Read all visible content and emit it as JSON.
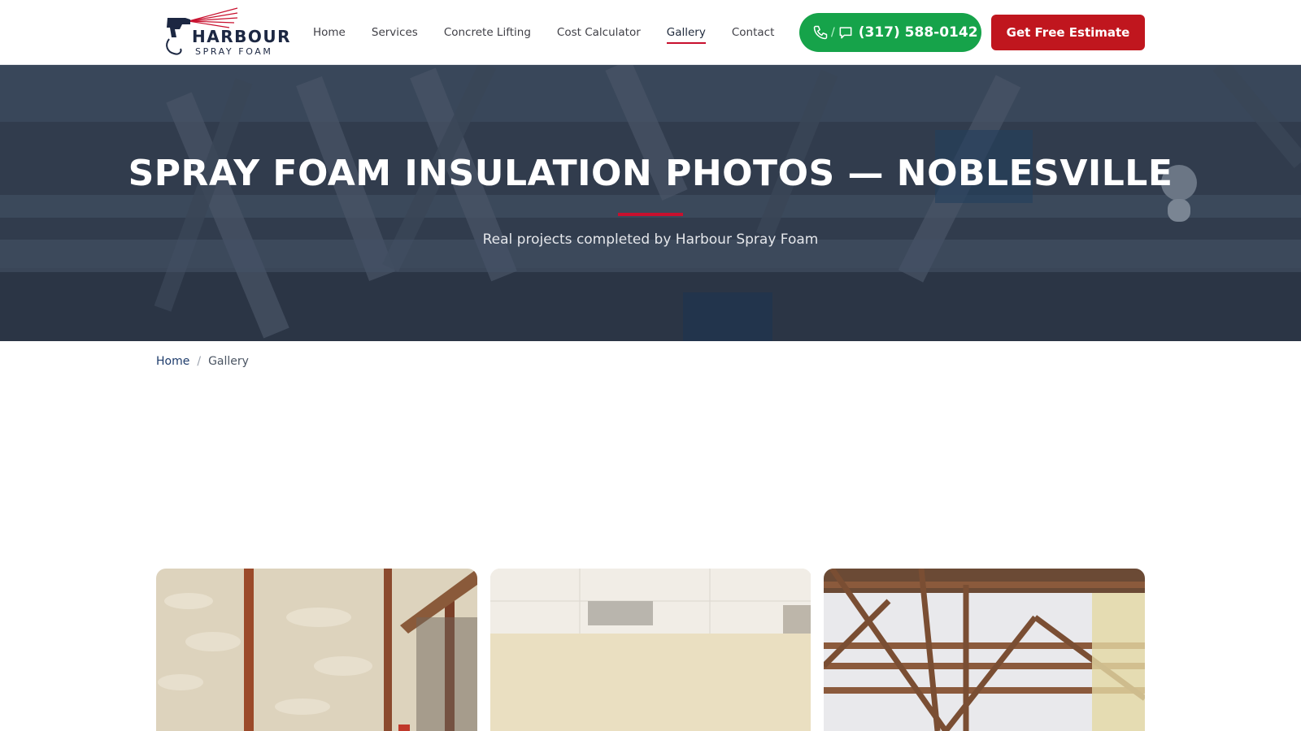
{
  "header": {
    "logo": {
      "name": "HARBOUR",
      "tagline": "SPRAY FOAM",
      "icon": "spray-gun-icon"
    },
    "nav": [
      {
        "label": "Home"
      },
      {
        "label": "Services"
      },
      {
        "label": "Concrete Lifting"
      },
      {
        "label": "Cost Calculator"
      },
      {
        "label": "Gallery",
        "active": true
      },
      {
        "label": "Contact"
      }
    ],
    "phone_button": {
      "number": "(317) 588-0142",
      "icons": [
        "phone-icon",
        "chat-icon"
      ],
      "separator": "/"
    },
    "estimate_button": {
      "label": "Get Free Estimate"
    }
  },
  "hero": {
    "title": "SPRAY FOAM INSULATION PHOTOS — NOBLESVILLE",
    "subtitle": "Real projects completed by Harbour Spray Foam"
  },
  "breadcrumb": {
    "home": "Home",
    "separator": "/",
    "current": "Gallery"
  },
  "gallery": {
    "items": [
      {
        "image": "spray foam insulated wall with wooden posts"
      },
      {
        "image": "ceiling with vent and cream walls"
      },
      {
        "image": "wooden roof trusses with insulation"
      }
    ]
  },
  "colors": {
    "brand_navy": "#1c2742",
    "accent_red": "#c0161e",
    "phone_green": "#16a34a"
  }
}
